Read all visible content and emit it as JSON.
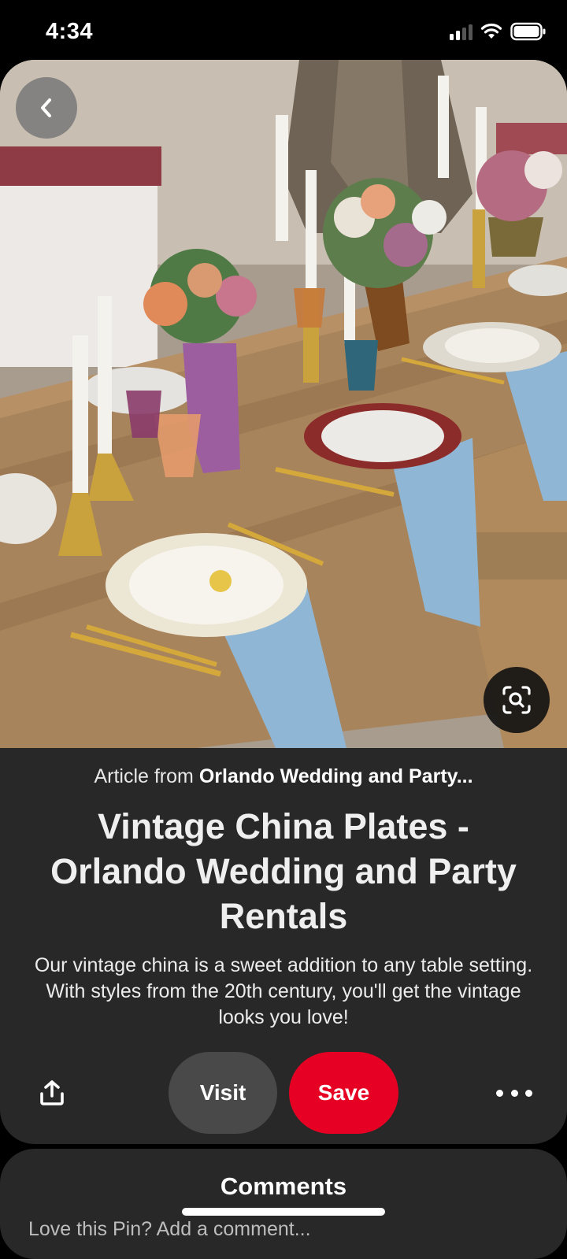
{
  "status_bar": {
    "time": "4:34",
    "icons": [
      "cellular-signal-icon",
      "wifi-icon",
      "battery-icon"
    ]
  },
  "pin": {
    "image_description_icon": "table-setting-photo",
    "back_icon": "chevron-left-icon",
    "visual_search_icon": "visual-search-icon",
    "source_prefix": "Article from ",
    "source_name": "Orlando Wedding and Party...",
    "title": "Vintage China Plates - Orlando Wedding and Party Rentals",
    "description": "Our vintage china is a sweet addition to any table setting. With styles from the 20th century, you'll get the vintage looks you love!"
  },
  "actions": {
    "share_icon": "share-icon",
    "visit_label": "Visit",
    "save_label": "Save",
    "more_icon": "more-dots-icon"
  },
  "comments": {
    "title": "Comments",
    "snippet": "Love this Pin? Add a comment..."
  },
  "colors": {
    "save_red": "#e60023",
    "card_bg": "#282828",
    "visit_bg": "#494949"
  }
}
